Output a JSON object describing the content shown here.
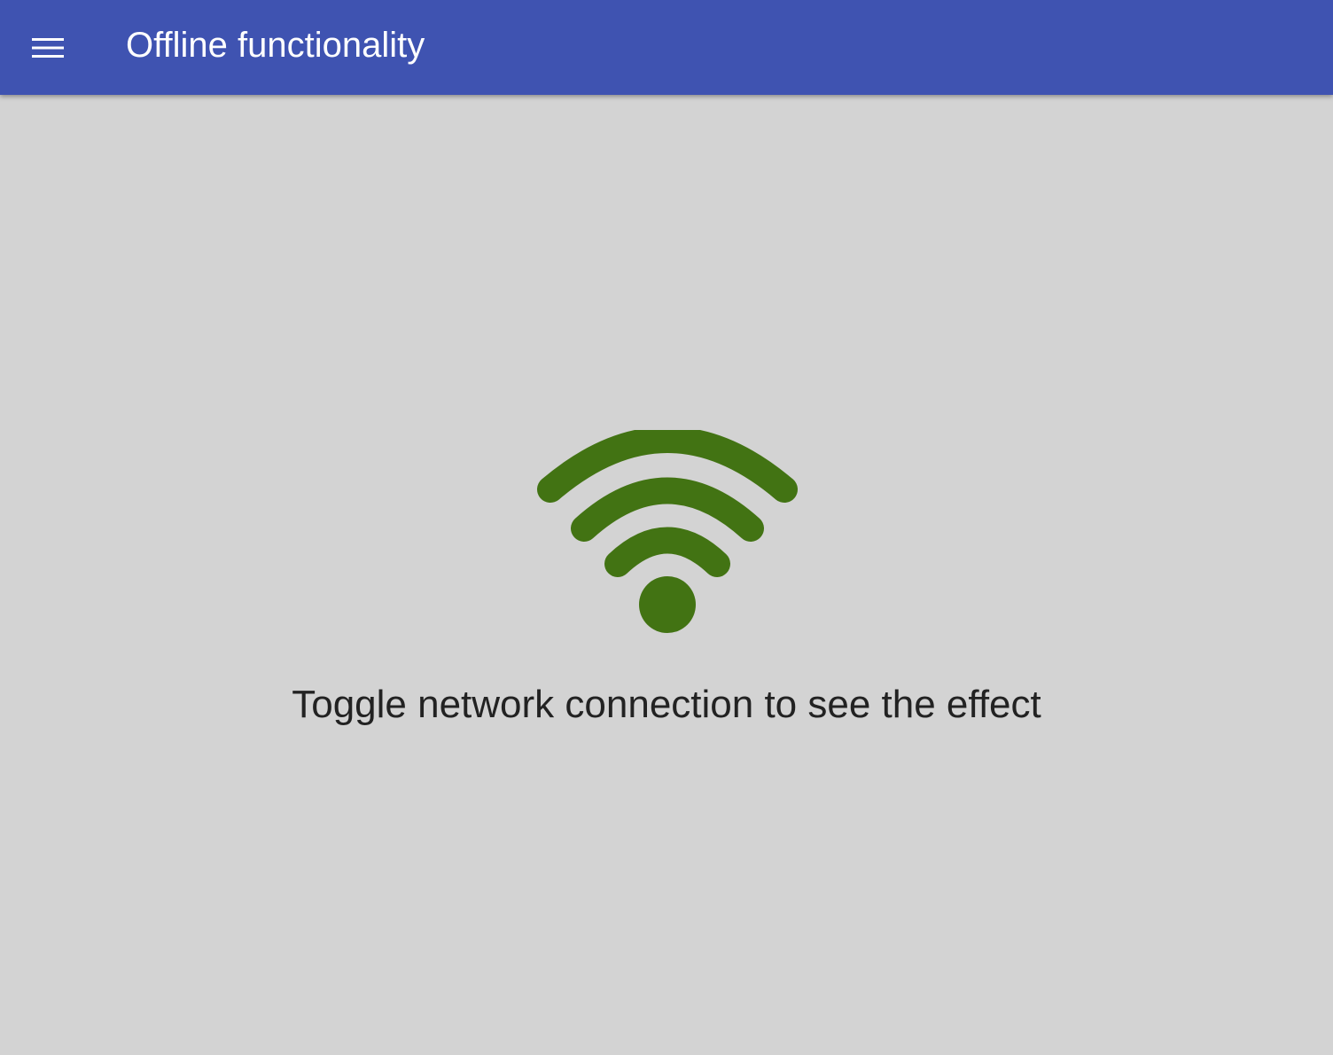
{
  "app_bar": {
    "title": "Offline functionality",
    "menu_icon": "hamburger-menu-icon",
    "background_color": "#3f53b1"
  },
  "main": {
    "status_icon": "wifi-icon",
    "status_icon_color": "#427313",
    "message": "Toggle network connection to see the effect",
    "background_color": "#d3d3d3"
  }
}
